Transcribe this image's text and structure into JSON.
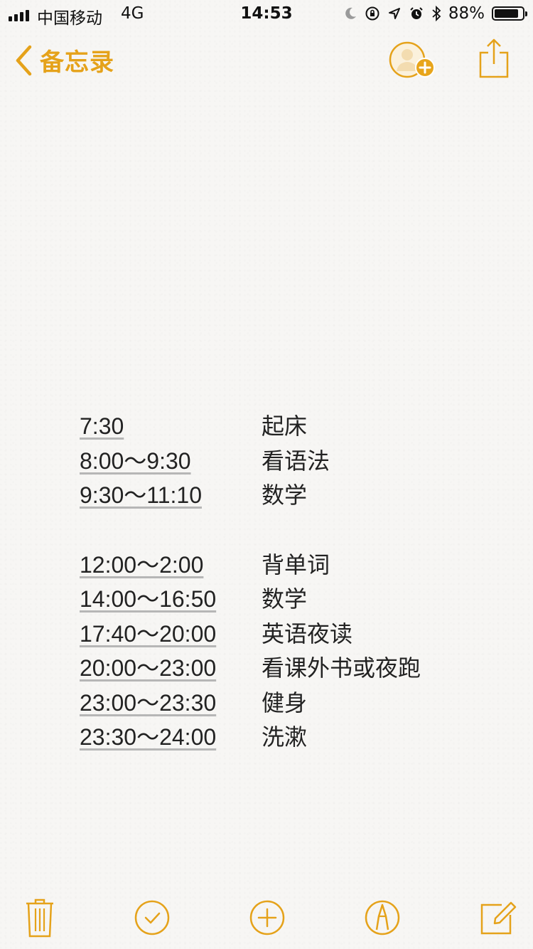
{
  "status_bar": {
    "carrier": "中国移动",
    "network": "4G",
    "time": "14:53",
    "battery": "88%",
    "battery_level": 0.88
  },
  "nav": {
    "back_label": "备忘录",
    "accent_color": "#e5a21a"
  },
  "note": {
    "rows_group1": [
      {
        "time": "7:30",
        "task": "起床"
      },
      {
        "time": "8:00～9:30",
        "task": "看语法"
      },
      {
        "time": "9:30～11:10",
        "task": "数学"
      }
    ],
    "rows_group2": [
      {
        "time": "12:00～2:00",
        "task": "背单词"
      },
      {
        "time": "14:00～16:50",
        "task": "数学"
      },
      {
        "time": "17:40～20:00",
        "task": "英语夜读"
      },
      {
        "time": "20:00～23:00",
        "task": "看课外书或夜跑"
      },
      {
        "time": "23:00～23:30",
        "task": "健身"
      },
      {
        "time": "23:30～24:00",
        "task": "洗漱"
      }
    ]
  },
  "toolbar": {
    "icons": [
      "trash-icon",
      "checklist-icon",
      "add-attachment-icon",
      "markup-icon",
      "compose-icon"
    ]
  }
}
